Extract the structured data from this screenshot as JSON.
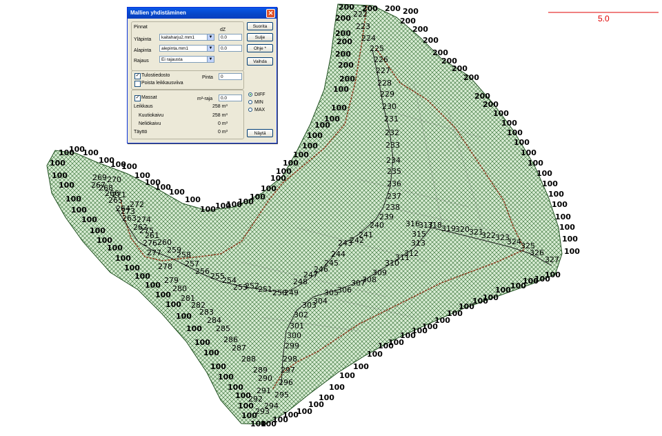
{
  "dialog": {
    "title": "Mallien yhdistäminen",
    "surfaces": {
      "heading": "Pinnat",
      "dz_header": "dZ",
      "top_label": "Yläpinta",
      "top_value": "kaitaharju2.mm1",
      "top_dz": "0.0",
      "bottom_label": "Alapinta",
      "bottom_value": "alepinta.mm1",
      "bottom_dz": "0.0",
      "boundary_label": "Rajaus",
      "boundary_value": "Ei rajausta"
    },
    "output": {
      "result_file_label": "Tulostiedosto",
      "result_file_checked": true,
      "surface_label": "Pinta",
      "surface_value": "0",
      "remove_section_label": "Poista leikkausviiva",
      "remove_section_checked": false
    },
    "masses": {
      "label": "Massat",
      "checked": true,
      "m2_limit_label": "m²-raja",
      "m2_limit_value": "0.0",
      "cut_label": "Leikkaus",
      "cut_value": "258 m³",
      "cubic_cut_label": "Kuutiokaivu",
      "cubic_cut_value": "258 m³",
      "square_cut_label": "Neliökaivu",
      "square_cut_value": "0 m³",
      "fill_label": "Täyttö",
      "fill_value": "0 m³",
      "options": [
        "DIFF",
        "MIN",
        "MAX"
      ],
      "selected_option": "DIFF"
    },
    "buttons": {
      "run": "Suorita",
      "close": "Sulje",
      "help": "Ohje *",
      "swap": "Vaihda",
      "show": "Näytä"
    },
    "close_glyph": "✕"
  },
  "map": {
    "scale_label": "5.0",
    "scale_color": "#e00000",
    "hatch_color": "#2e6b2e",
    "fill_color": "#d8ecd4",
    "line_color": "#8b3a1e",
    "boundary_labels": [
      "100",
      "200"
    ],
    "station_labels": [
      "222",
      "223",
      "224",
      "225",
      "226",
      "227",
      "228",
      "229",
      "230",
      "231",
      "232",
      "233",
      "234",
      "235",
      "236",
      "237",
      "238",
      "239",
      "240",
      "241",
      "242",
      "243",
      "244",
      "245",
      "246",
      "247",
      "248",
      "249",
      "250",
      "251",
      "252",
      "253",
      "254",
      "255",
      "256",
      "257",
      "258",
      "259",
      "260",
      "261",
      "262",
      "263",
      "264",
      "265",
      "266",
      "267",
      "268",
      "269",
      "270",
      "271",
      "272",
      "273",
      "274",
      "275",
      "276",
      "277",
      "278",
      "279",
      "280",
      "281",
      "282",
      "283",
      "284",
      "285",
      "286",
      "287",
      "288",
      "289",
      "290",
      "291",
      "292",
      "293",
      "294",
      "295",
      "296",
      "297",
      "298",
      "299",
      "300",
      "301",
      "302",
      "303",
      "304",
      "305",
      "306",
      "307",
      "308",
      "309",
      "310",
      "311",
      "312",
      "313",
      "315",
      "316",
      "317",
      "318",
      "319",
      "320",
      "321",
      "322",
      "323",
      "324",
      "325",
      "326",
      "327"
    ]
  }
}
